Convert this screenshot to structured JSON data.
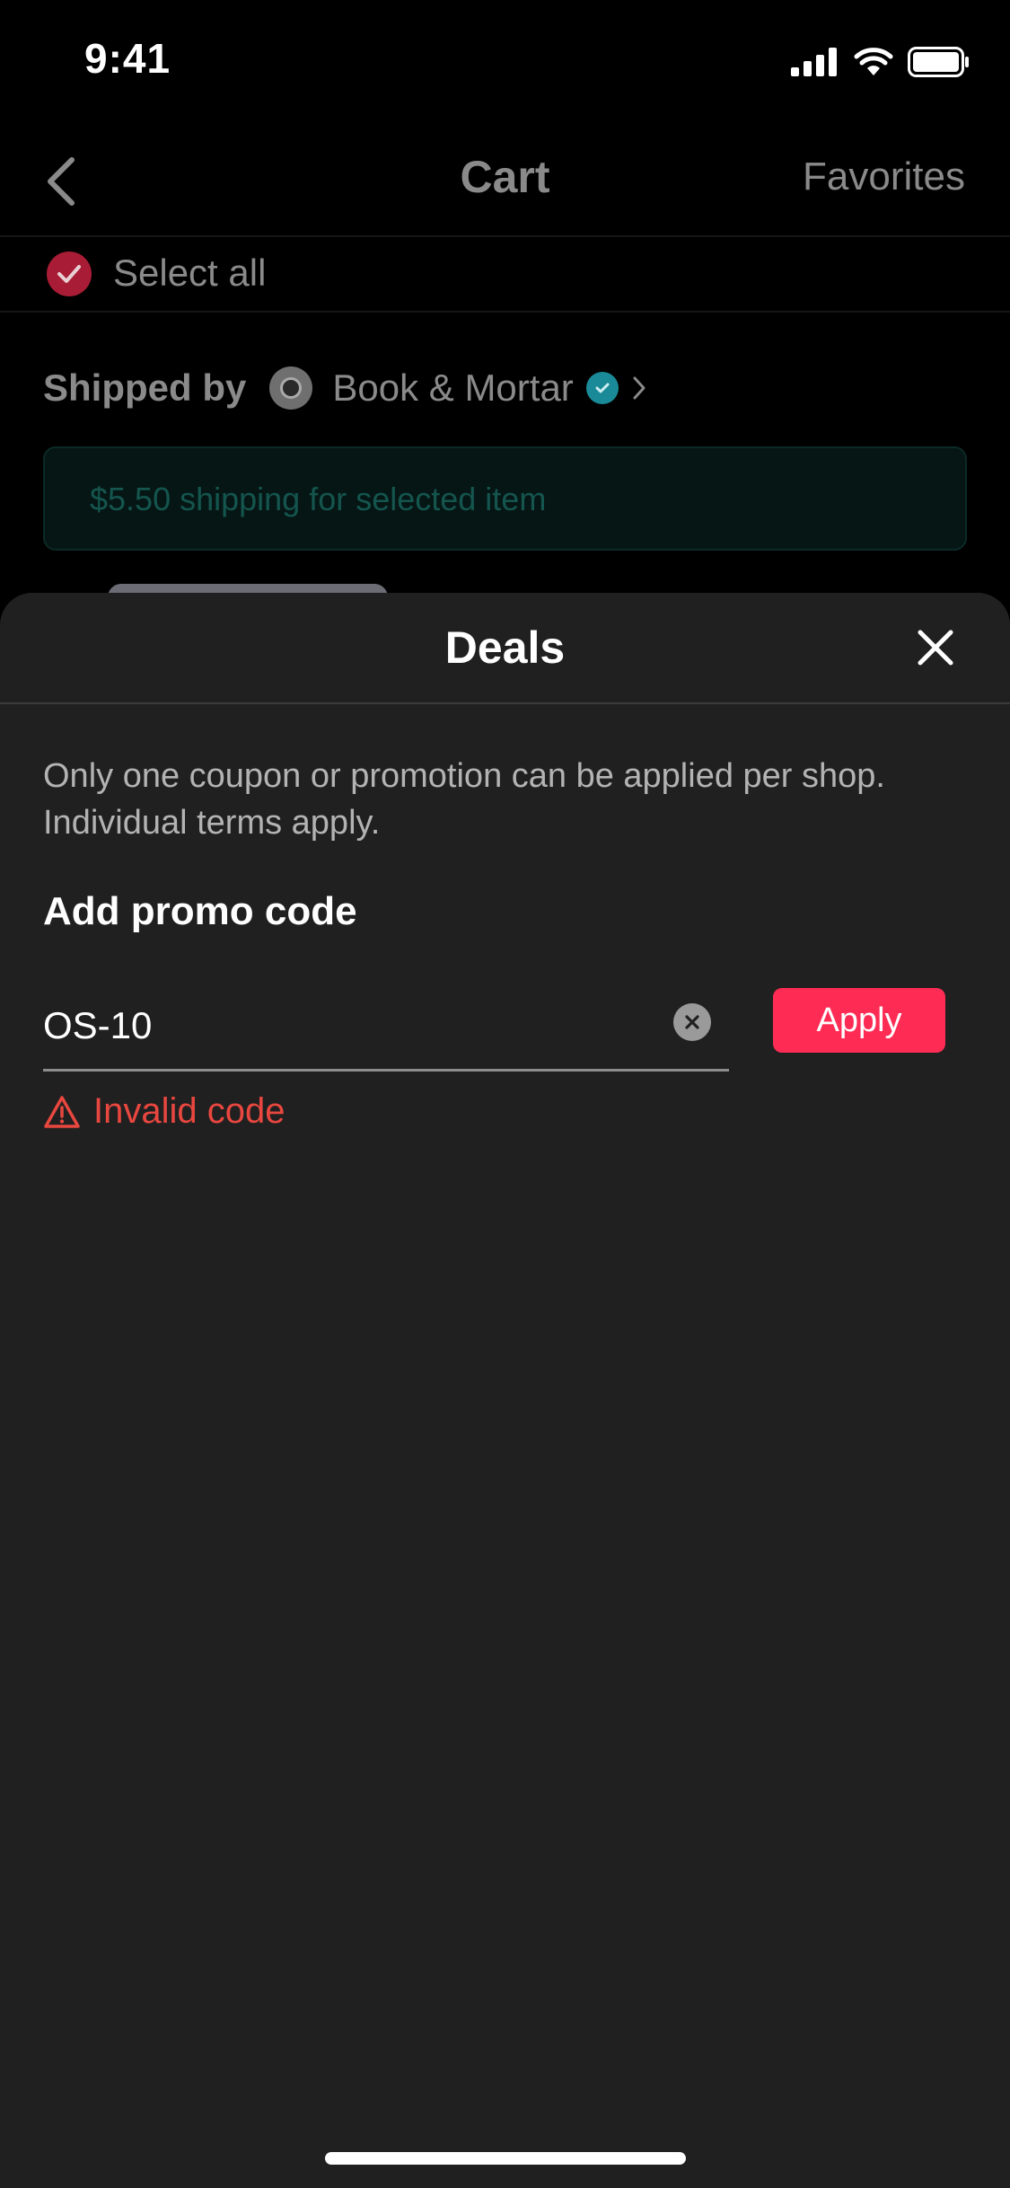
{
  "status_bar": {
    "time": "9:41"
  },
  "cart_header": {
    "title": "Cart",
    "favorites_label": "Favorites"
  },
  "select_all": {
    "label": "Select all",
    "checked": true
  },
  "shop": {
    "shipped_by_label": "Shipped by",
    "name": "Book & Mortar"
  },
  "shipping_banner": {
    "text": "$5.50 shipping for selected item"
  },
  "deals_sheet": {
    "title": "Deals",
    "notice": "Only one coupon or promotion can be applied per shop. Individual terms apply.",
    "promo_heading": "Add promo code",
    "promo_value": "OS-10",
    "apply_label": "Apply",
    "error_text": "Invalid code"
  },
  "colors": {
    "accent": "#fe2c55",
    "error": "#e8473f",
    "sheet_background": "#202020",
    "verified_badge": "#1a8a98"
  }
}
